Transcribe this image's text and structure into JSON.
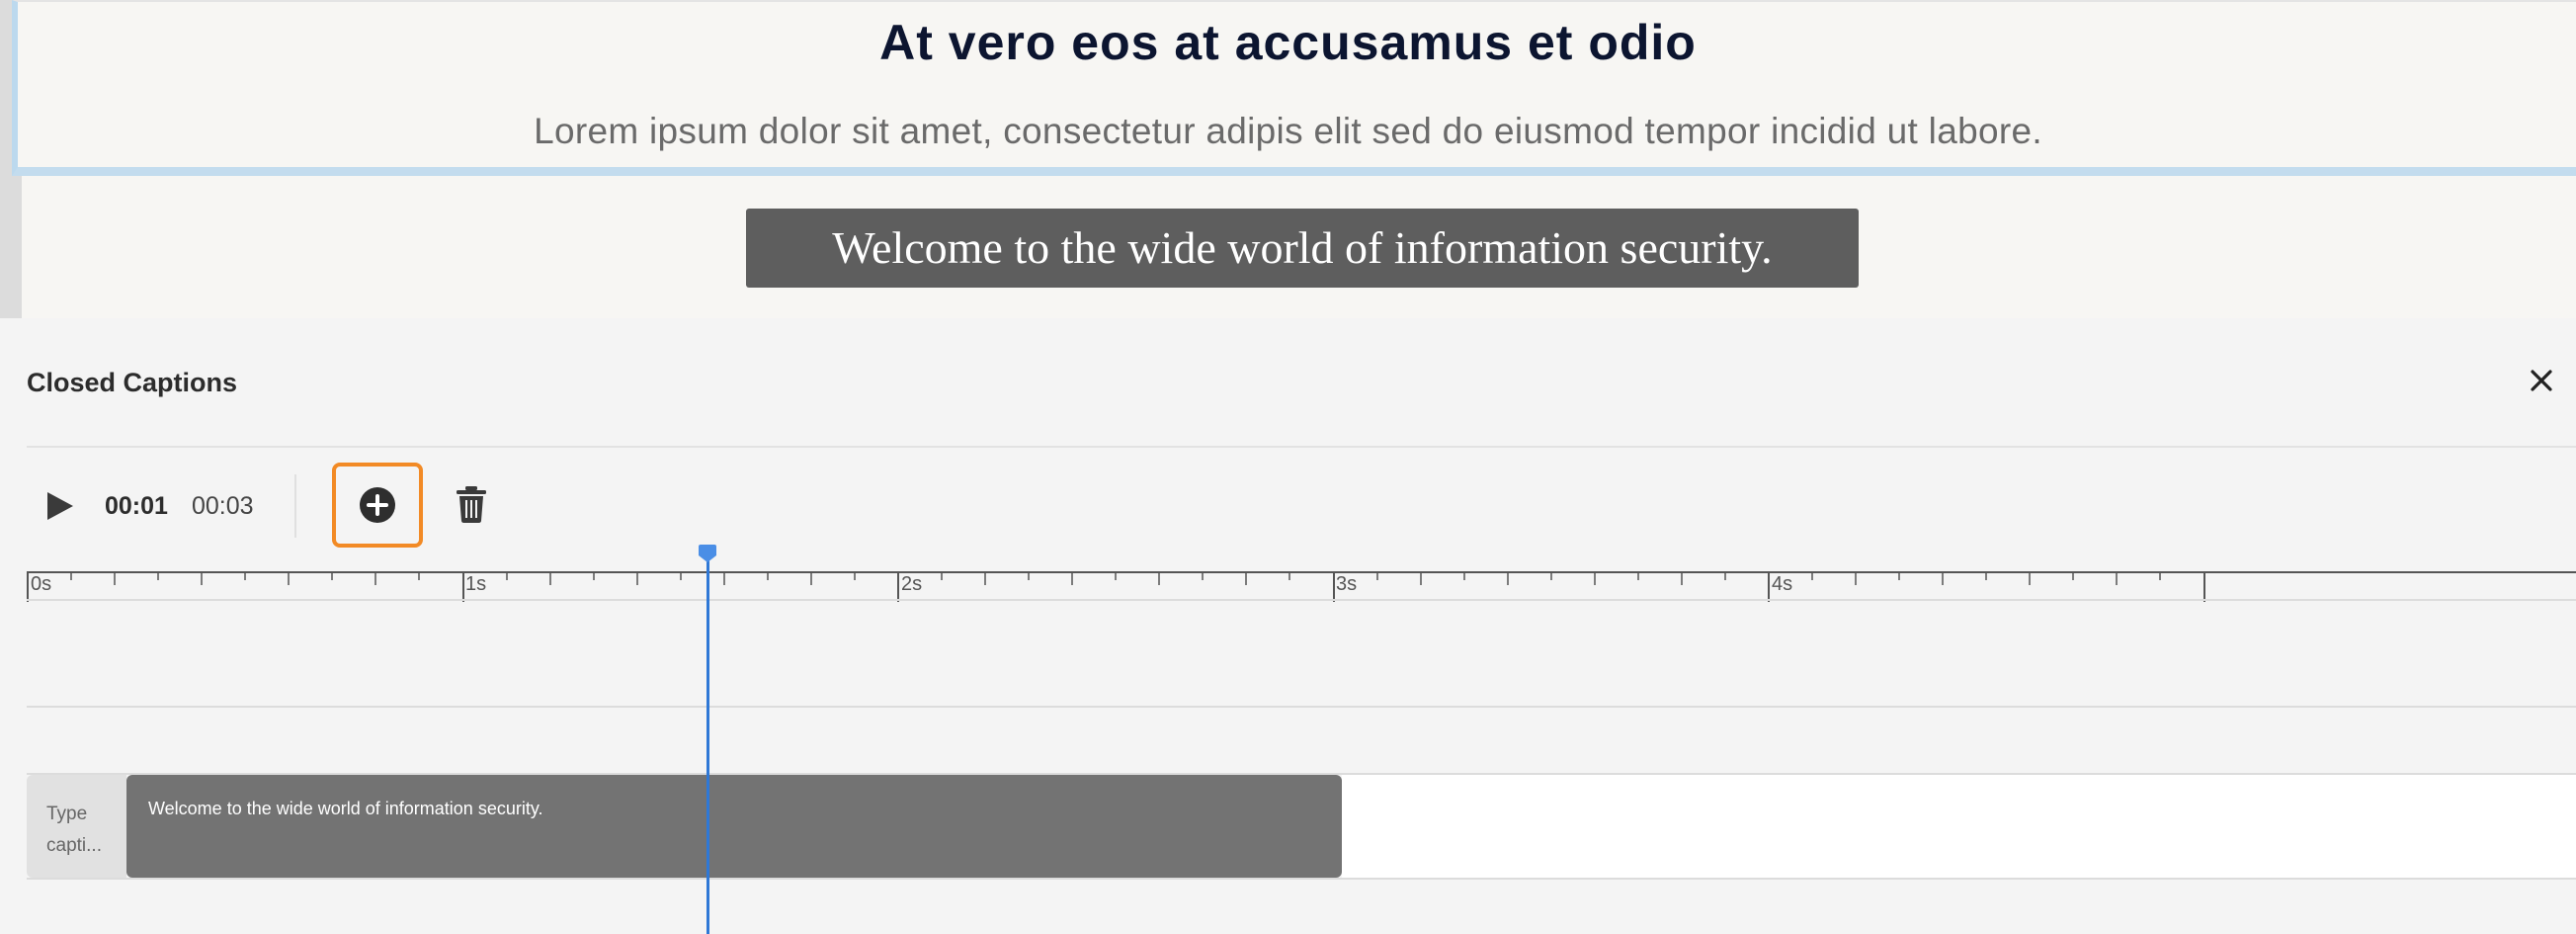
{
  "preview": {
    "title": "At vero eos at accusamus et odio",
    "subtitle": "Lorem ipsum dolor sit amet, consectetur adipis elit sed do eiusmod tempor incidid ut labore.",
    "caption_text": "Welcome to the wide world of information security."
  },
  "panel": {
    "title": "Closed Captions",
    "close_icon": "close-icon"
  },
  "toolbar": {
    "play_icon": "play-icon",
    "current_time": "00:01",
    "total_time": "00:03",
    "add_icon": "add-circle-icon",
    "delete_icon": "trash-icon"
  },
  "timeline": {
    "ruler_labels": [
      "0s",
      "1s",
      "2s",
      "3s",
      "4s"
    ],
    "playhead_time_s": 1.57,
    "tracks": [
      {
        "placeholder": "Type capti...",
        "placeholder_line1": "Type",
        "placeholder_line2": "capti...",
        "caption": {
          "text": "Welcome to the wide world of information security.",
          "start_s": 0.0,
          "end_s": 3.0
        }
      }
    ]
  },
  "colors": {
    "accent_highlight": "#f28a25",
    "playhead": "#2f78d6",
    "caption_block": "#737373"
  }
}
